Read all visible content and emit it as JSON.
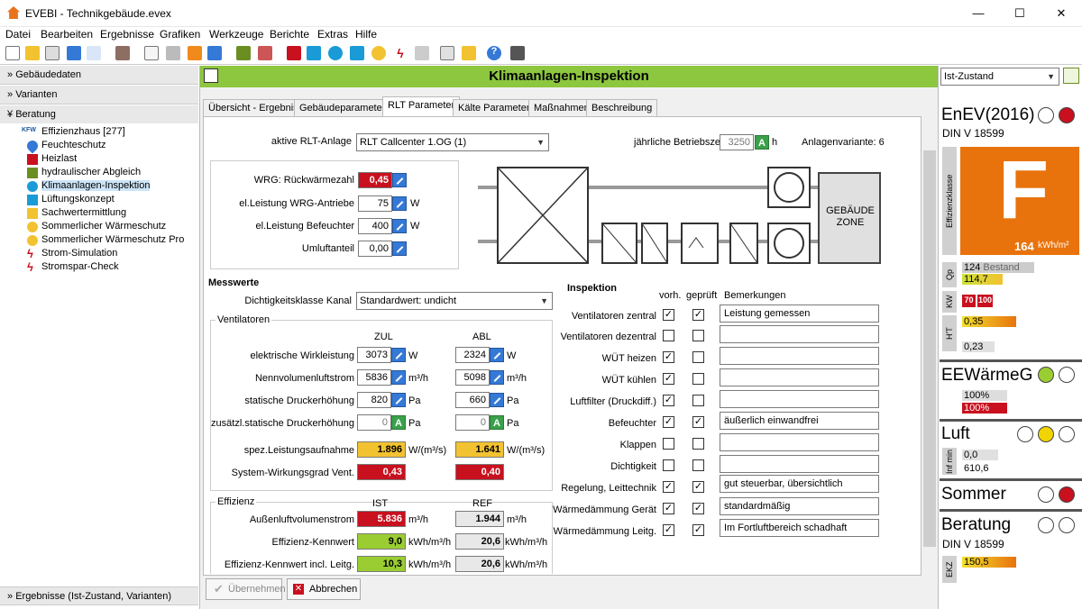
{
  "window": {
    "title": "EVEBI - Technikgebäude.evex",
    "min": "—",
    "max": "☐",
    "close": "✕"
  },
  "menu": [
    "Datei",
    "Bearbeiten",
    "Ergebnisse",
    "Grafiken",
    "Werkzeuge",
    "Berichte",
    "Extras",
    "Hilfe"
  ],
  "colors": {
    "accent_green": "#8dc63f",
    "red": "#c8101e",
    "yellow": "#f2c230",
    "orange": "#e8730c"
  },
  "left": {
    "sections": [
      "Gebäudedaten",
      "Varianten",
      "Beratung"
    ],
    "items": [
      "Effizienzhaus [277]",
      "Feuchteschutz",
      "Heizlast",
      "hydraulischer Abgleich",
      "Klimaanlagen-Inspektion",
      "Lüftungskonzept",
      "Sachwertermittlung",
      "Sommerlicher Wärmeschutz",
      "Sommerlicher Wärmeschutz Pro",
      "Strom-Simulation",
      "Stromspar-Check"
    ],
    "kfw": "KFW",
    "bottom": "Ergebnisse (Ist-Zustand, Varianten)"
  },
  "header": {
    "title": "Klimaanlagen-Inspektion"
  },
  "tabs": [
    "Übersicht - Ergebnis",
    "Gebäudeparameter",
    "RLT Parameter",
    "Kälte Parameter",
    "Maßnahmen",
    "Beschreibung"
  ],
  "rlt": {
    "active_label": "aktive RLT-Anlage",
    "active_value": "RLT Callcenter 1.OG (1)",
    "hours_label": "jährliche Betriebszeit",
    "hours_value": "3250",
    "hours_unit": "h",
    "variant": "Anlagenvariante: 6",
    "wrg_label": "WRG: Rückwärmezahl",
    "wrg_value": "0,45",
    "el_wrg_label": "el.Leistung WRG-Antriebe",
    "el_wrg_value": "75",
    "el_bef_label": "el.Leistung Befeuchter",
    "el_bef_value": "400",
    "umluft_label": "Umluftanteil",
    "umluft_value": "0,00",
    "unit_w": "W",
    "zone": "GEBÄUDE ZONE"
  },
  "mess": {
    "title": "Messwerte",
    "dicht_label": "Dichtigkeitsklasse Kanal",
    "dicht_value": "Standardwert: undicht",
    "vent_group": "Ventilatoren",
    "zul": "ZUL",
    "abl": "ABL",
    "rows": [
      {
        "label": "elektrische Wirkleistung",
        "zul": "3073",
        "abl": "2324",
        "unit": "W"
      },
      {
        "label": "Nennvolumenluftstrom",
        "zul": "5836",
        "abl": "5098",
        "unit": "m³/h"
      },
      {
        "label": "statische Druckerhöhung",
        "zul": "820",
        "abl": "660",
        "unit": "Pa"
      },
      {
        "label": "zusätzl.statische Druckerhöhung",
        "zul": "0",
        "abl": "0",
        "unit": "Pa"
      }
    ],
    "spez_label": "spez.Leistungsaufnahme",
    "spez_zul": "1.896",
    "spez_abl": "1.641",
    "spez_unit": "W/(m³/s)",
    "sys_label": "System-Wirkungsgrad Vent.",
    "sys_zul": "0,43",
    "sys_abl": "0,40",
    "eff_group": "Effizienz",
    "ist": "IST",
    "ref": "REF",
    "eff_rows": [
      {
        "label": "Außenluftvolumenstrom",
        "ist": "5.836",
        "ref": "1.944",
        "unit": "m³/h"
      },
      {
        "label": "Effizienz-Kennwert",
        "ist": "9,0",
        "ref": "20,6",
        "unit": "kWh/m³/h"
      },
      {
        "label": "Effizienz-Kennwert incl. Leitg.",
        "ist": "10,3",
        "ref": "20,6",
        "unit": "kWh/m³/h"
      }
    ]
  },
  "insp": {
    "title": "Inspektion",
    "vorh": "vorh.",
    "gepr": "geprüft",
    "bem": "Bemerkungen",
    "rows": [
      {
        "label": "Ventilatoren zentral",
        "v": "✓",
        "g": "✓",
        "r": "Leistung gemessen"
      },
      {
        "label": "Ventilatoren dezentral",
        "v": "",
        "g": "",
        "r": ""
      },
      {
        "label": "WÜT heizen",
        "v": "✓",
        "g": "",
        "r": ""
      },
      {
        "label": "WÜT kühlen",
        "v": "✓",
        "g": "",
        "r": ""
      },
      {
        "label": "Luftfilter (Druckdiff.)",
        "v": "✓",
        "g": "",
        "r": ""
      },
      {
        "label": "Befeuchter",
        "v": "✓",
        "g": "✓",
        "r": "äußerlich einwandfrei"
      },
      {
        "label": "Klappen",
        "v": "",
        "g": "",
        "r": ""
      },
      {
        "label": "Dichtigkeit",
        "v": "",
        "g": "",
        "r": ""
      },
      {
        "label": "Regelung, Leittechnik",
        "v": "✓",
        "g": "✓",
        "r": "gut steuerbar, übersichtlich"
      },
      {
        "label": "Wärmedämmung Gerät",
        "v": "✓",
        "g": "✓",
        "r": "standardmäßig"
      },
      {
        "label": "Wärmedämmung Leitg.",
        "v": "✓",
        "g": "✓",
        "r": "Im Fortluftbereich schadhaft"
      }
    ]
  },
  "buttons": {
    "apply": "Übernehmen",
    "cancel": "Abbrechen"
  },
  "right": {
    "state": "Ist-Zustand",
    "enev": "EnEV(2016)",
    "din": "DIN V 18599",
    "eff_class_label": "Effizienzklasse",
    "class": "F",
    "kwh_value": "164",
    "kwh_unit": "kWh/m²",
    "qp_label": "Qp",
    "qp1": "124",
    "qp1b": "Bestand",
    "qp2": "114,7",
    "kw_label": "KW",
    "kw1": "70",
    "kw2": "100",
    "ht_label": "H'T",
    "ht1": "0,35",
    "ht2": "0,23",
    "eew": "EEWärmeG",
    "eew1": "100%",
    "eew2": "100%",
    "luft": "Luft",
    "inf_label": "Inf min",
    "luft1": "0,0",
    "luft2": "610,6",
    "sommer": "Sommer",
    "beratung": "Beratung",
    "din2": "DIN V 18599",
    "ekz_label": "EKZ",
    "ekz": "150,5",
    "progress": {
      "qp2": 0.45,
      "ht1": 0.6,
      "eew1": 0.5,
      "eew2": 0.5,
      "ekz": 0.6
    }
  }
}
